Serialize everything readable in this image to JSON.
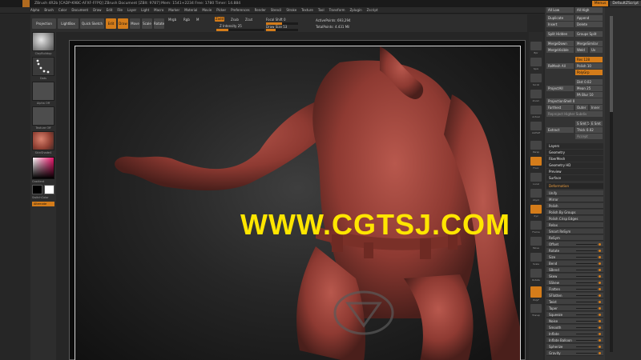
{
  "app": {
    "title": "ZBrush 4R2b  [CADP-K9BC-AFXF-FFPQ]   ZBrush Document   [ZBlt: 9787]  Mem: 1541+2234  Free: 1780  Timer: 14.884",
    "menu_button": "Menus",
    "script_button": "DefaultZScript"
  },
  "menu": [
    "Alpha",
    "Brush",
    "Color",
    "Document",
    "Draw",
    "Edit",
    "File",
    "Layer",
    "Light",
    "Macro",
    "Marker",
    "Material",
    "Movie",
    "Picker",
    "Preferences",
    "Render",
    "Stencil",
    "Stroke",
    "Texture",
    "Tool",
    "Transform",
    "Zplugin",
    "Zscript"
  ],
  "toolbar": {
    "projection_master": "Projection Master",
    "lightbox": "LightBox",
    "quick_sketch": "Quick Sketch",
    "edit": "Edit",
    "draw": "Draw",
    "move": "Move",
    "scale": "Scale",
    "rotate": "Rotate",
    "mrgb": "Mrgb",
    "rgb": "Rgb",
    "m": "M",
    "zadd": "Zadd",
    "zsub": "Zsub",
    "zcut": "Zcut",
    "z_intensity": "Z Intensity 25",
    "focal_shift": "Focal Shift 0",
    "draw_size": "Draw Size 53",
    "active_points": "ActivePoints: 693,294",
    "total_points": "TotalPoints: 4.431 Mil"
  },
  "left_shelf": {
    "brush": "ClayBuildup",
    "stroke": "Dots",
    "alpha": "Alpha Off",
    "texture": "Texture Off",
    "material": "SkinShade4",
    "gradient": "Gradient",
    "switch_color": "SwitchColor",
    "alternate": "Alternate"
  },
  "canvas": {
    "watermark": "WWW.CGTSJ.COM"
  },
  "icon_strip": [
    "Bpr",
    "Spix",
    "Scroll",
    "Zoom",
    "Actual",
    "AAHalf",
    "Persp",
    "Floor",
    "Local",
    "LSym",
    "Xyz",
    "Frame",
    "Move",
    "Scale",
    "Rotate",
    "PolyF",
    "Transp"
  ],
  "palette": {
    "all_low": "All Low",
    "all_high": "All High",
    "duplicate": "Duplicate",
    "append": "Append",
    "insert": "Insert",
    "delete": "Delete",
    "split_hidden": "Split Hidden",
    "groups_split": "Groups Split",
    "merge_down": "MergeDown",
    "merge_similar": "MergeSimilar",
    "merge_visible": "MergeVisible",
    "weld": "Weld",
    "uv": "Uv",
    "res": "Res 128",
    "remesh_all": "ReMesh All",
    "polish": "Polish 10",
    "polygrp": "PolyGrp",
    "dist": "Dist 0.02",
    "project_all": "ProjectAll",
    "mean": "Mean 25",
    "pa_blur": "PA Blur 10",
    "projection_shell": "ProjectionShell 0",
    "farthest": "Farthest",
    "outer": "Outer",
    "inner": "Inner",
    "reproject": "Reproject Higher Subdiv",
    "extract": "Extract",
    "s_smt": "S Smt 5",
    "e_smt": "E Smt",
    "thick": "Thick 0.02",
    "accept": "Accept",
    "sections": [
      "Layers",
      "Geometry",
      "FiberMesh",
      "Geometry HD",
      "Preview",
      "Surface",
      "Deformation"
    ],
    "deformation": [
      "Unify",
      "Mirror",
      "Polish",
      "Polish By Groups",
      "Polish Crisp Edges",
      "Relax",
      "Smart ReSym",
      "ReSym",
      "Offset",
      "Rotate",
      "Size",
      "Bend",
      "SBend",
      "Skew",
      "SSkew",
      "Flatten",
      "SFlatten",
      "Twist",
      "Taper",
      "Squeeze",
      "Noise",
      "Smooth",
      "Inflate",
      "Inflate Balloon",
      "Spherize",
      "Gravity"
    ]
  }
}
